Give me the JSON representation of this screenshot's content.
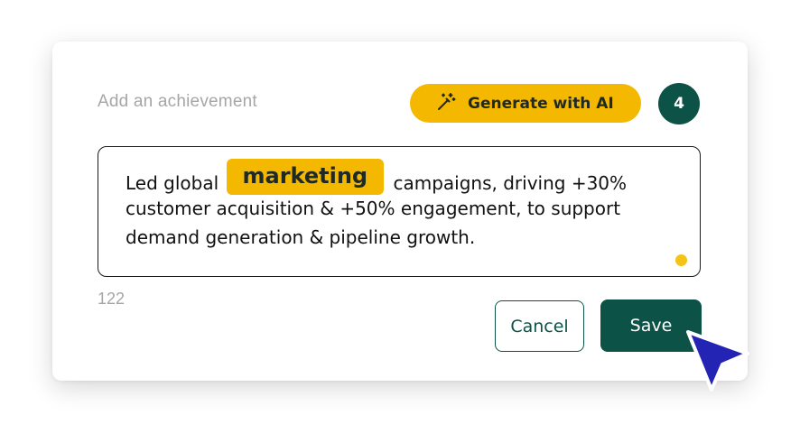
{
  "form": {
    "label": "Add an achievement",
    "generate_button": "Generate with AI",
    "count_badge": "4",
    "text": {
      "prefix": "Led global",
      "highlight": "marketing",
      "suffix": "campaigns, driving +30%",
      "line2": "customer acquisition & +50% engagement, to support",
      "line3": "demand generation & pipeline growth."
    },
    "char_count": "122",
    "cancel_label": "Cancel",
    "save_label": "Save"
  },
  "colors": {
    "accent_yellow": "#f5b800",
    "brand_green": "#0d5246",
    "cursor_blue": "#2323b4"
  },
  "icons": {
    "generate": "magic-wand-icon",
    "pointer": "mouse-pointer-icon"
  }
}
